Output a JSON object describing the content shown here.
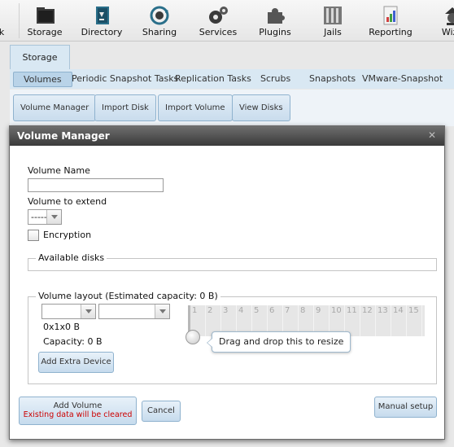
{
  "toolbar": {
    "items": [
      {
        "label": "k",
        "icon": "account-icon"
      },
      {
        "label": "Storage",
        "icon": "storage-icon"
      },
      {
        "label": "Directory",
        "icon": "directory-icon"
      },
      {
        "label": "Sharing",
        "icon": "sharing-icon"
      },
      {
        "label": "Services",
        "icon": "services-icon"
      },
      {
        "label": "Plugins",
        "icon": "plugins-icon"
      },
      {
        "label": "Jails",
        "icon": "jails-icon"
      },
      {
        "label": "Reporting",
        "icon": "reporting-icon"
      },
      {
        "label": "Wiza",
        "icon": "wizard-icon"
      }
    ]
  },
  "page": {
    "main_tab": "Storage",
    "subtabs": [
      "Volumes",
      "Periodic Snapshot Tasks",
      "Replication Tasks",
      "Scrubs",
      "Snapshots",
      "VMware-Snapshot"
    ],
    "actions": [
      "Volume Manager",
      "Import Disk",
      "Import Volume",
      "View Disks"
    ]
  },
  "modal": {
    "title": "Volume Manager",
    "volume_name_label": "Volume Name",
    "volume_name_value": "",
    "volume_to_extend_label": "Volume to extend",
    "volume_to_extend_value": "-----",
    "encryption_label": "Encryption",
    "encryption_checked": false,
    "available_disks_label": "Available disks",
    "layout_label": "Volume layout (Estimated capacity: 0 B)",
    "layout_dims": "0x1x0 B",
    "capacity_text": "Capacity: 0 B",
    "grid_columns": [
      "1",
      "2",
      "3",
      "4",
      "5",
      "6",
      "7",
      "8",
      "9",
      "10",
      "11",
      "12",
      "13",
      "14",
      "15"
    ],
    "tooltip": "Drag and drop this to resize",
    "add_extra_device": "Add Extra Device",
    "add_volume": "Add Volume",
    "add_volume_warning": "Existing data will be cleared",
    "cancel": "Cancel",
    "manual_setup": "Manual setup"
  },
  "colors": {
    "titlebar": "#3a3a3a",
    "button_border": "#8fb2ce",
    "warning": "#cc0000",
    "tab_bg": "#d9e8f3"
  }
}
